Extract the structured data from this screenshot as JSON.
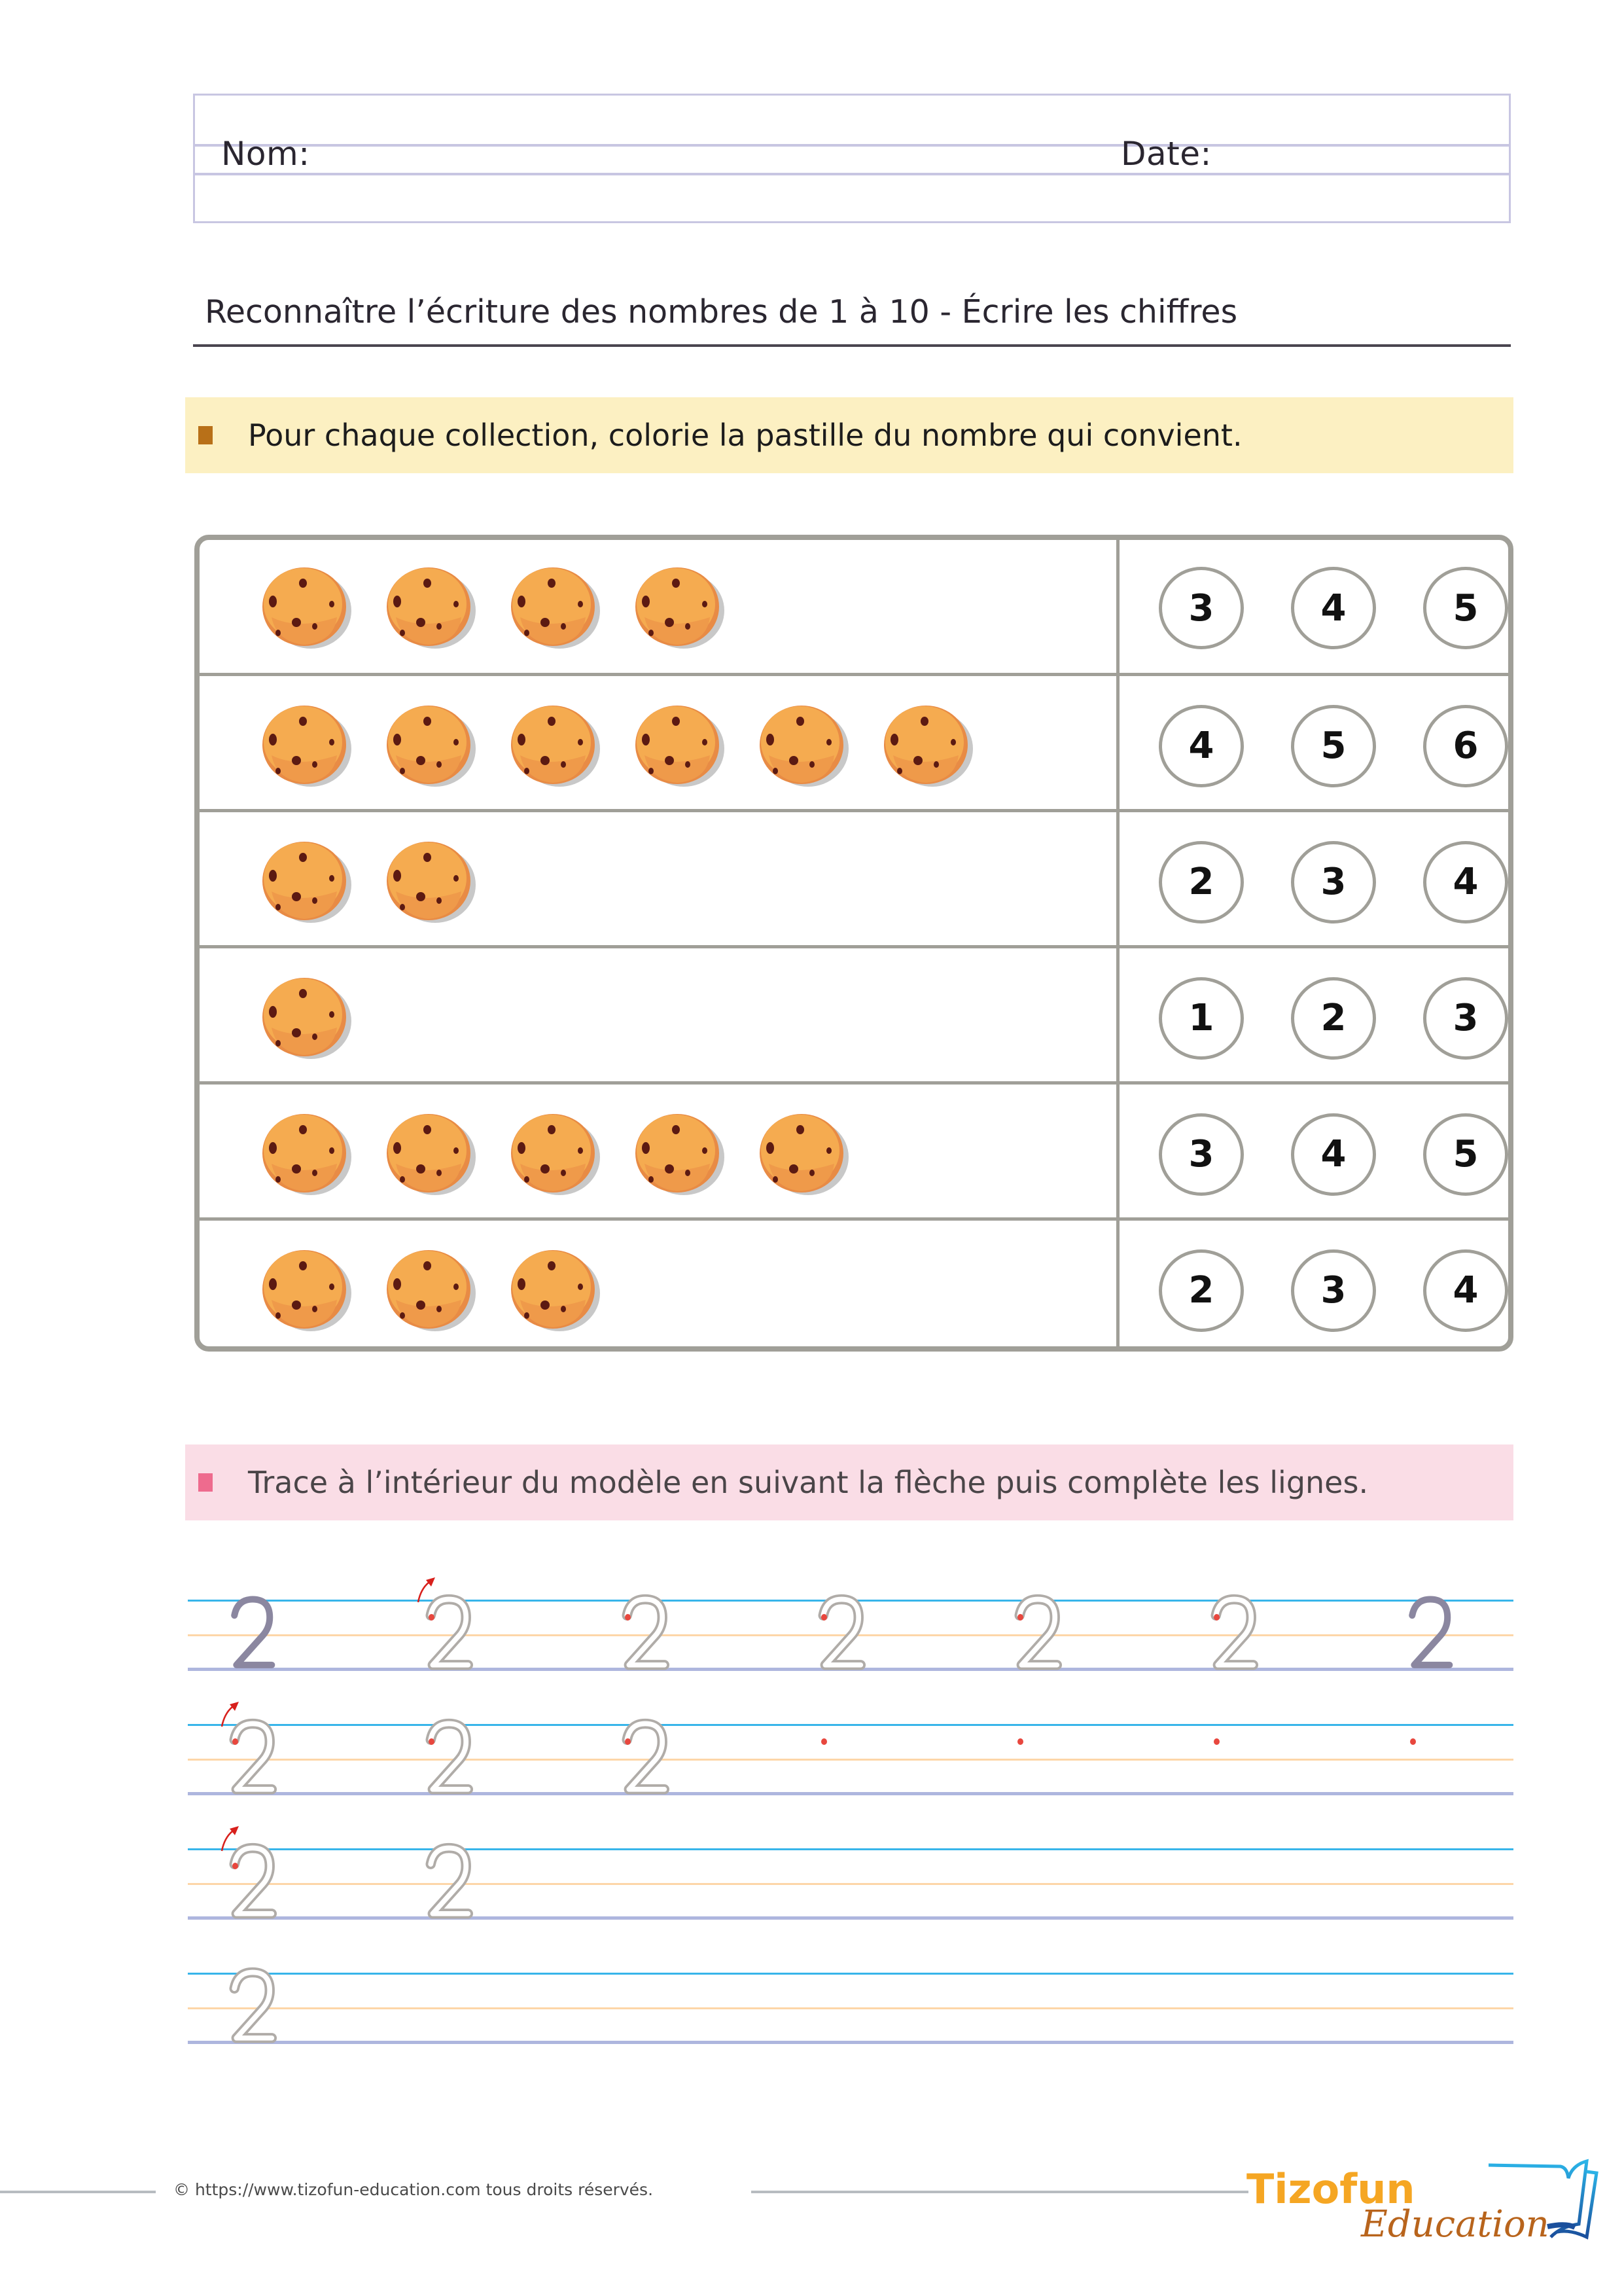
{
  "header": {
    "name_label": "Nom:",
    "date_label": "Date:"
  },
  "title": "Reconnaître l’écriture des nombres de 1 à 10 - Écrire les chiffres",
  "exercise1": {
    "instruction": "Pour chaque collection, colorie la pastille du nombre qui convient.",
    "accent_color": "#b87018",
    "band_color": "#fcf0c2",
    "rows": [
      {
        "cookie_count": 4,
        "options": [
          "3",
          "4",
          "5"
        ]
      },
      {
        "cookie_count": 6,
        "options": [
          "4",
          "5",
          "6"
        ]
      },
      {
        "cookie_count": 2,
        "options": [
          "2",
          "3",
          "4"
        ]
      },
      {
        "cookie_count": 1,
        "options": [
          "1",
          "2",
          "3"
        ]
      },
      {
        "cookie_count": 5,
        "options": [
          "3",
          "4",
          "5"
        ]
      },
      {
        "cookie_count": 3,
        "options": [
          "2",
          "3",
          "4"
        ]
      }
    ]
  },
  "exercise2": {
    "instruction": "Trace à l’intérieur du modèle en suivant la flèche puis complète les lignes.",
    "accent_color": "#ee6b8e",
    "band_color": "#fadde6",
    "digit": "2",
    "lines": [
      [
        "model",
        "trace-arrow",
        "trace-dot",
        "trace-dot",
        "trace-dot",
        "trace-dot",
        "model"
      ],
      [
        "trace-arrow",
        "trace-dot",
        "trace-dot",
        "dot",
        "dot",
        "dot",
        "dot"
      ],
      [
        "trace-arrow",
        "trace"
      ],
      [
        "trace"
      ]
    ]
  },
  "footer": {
    "copyright": "© https://www.tizofun-education.com tous droits réservés.",
    "logo_top": "Tizofun",
    "logo_bottom": "Education"
  }
}
